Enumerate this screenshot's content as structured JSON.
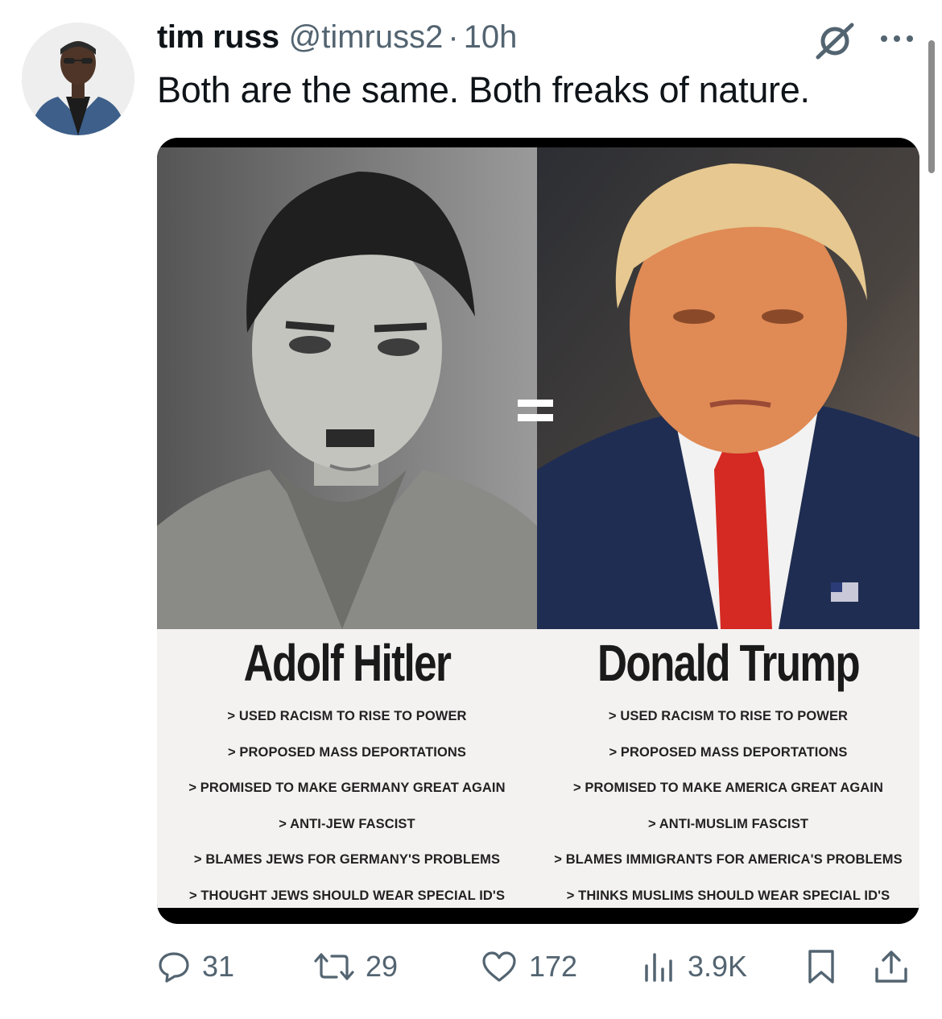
{
  "author": {
    "display_name": "tim russ",
    "handle": "@timruss2",
    "separator": "·",
    "time": "10h"
  },
  "tweet": {
    "text": "Both are the same.  Both freaks of nature."
  },
  "media": {
    "left_column": {
      "name": "Adolf Hitler",
      "points": [
        "> USED RACISM TO RISE TO POWER",
        "> PROPOSED MASS DEPORTATIONS",
        "> PROMISED TO MAKE GERMANY GREAT AGAIN",
        "> ANTI-JEW FASCIST",
        "> BLAMES JEWS FOR GERMANY'S PROBLEMS",
        "> THOUGHT JEWS SHOULD WEAR SPECIAL ID'S"
      ]
    },
    "right_column": {
      "name": "Donald Trump",
      "points": [
        "> USED RACISM TO RISE TO POWER",
        "> PROPOSED MASS DEPORTATIONS",
        "> PROMISED TO MAKE AMERICA GREAT AGAIN",
        "> ANTI-MUSLIM FASCIST",
        "> BLAMES IMMIGRANTS FOR AMERICA'S PROBLEMS",
        "> THINKS MUSLIMS SHOULD WEAR SPECIAL ID'S"
      ]
    }
  },
  "actions": {
    "replies": "31",
    "reposts": "29",
    "likes": "172",
    "views": "3.9K"
  },
  "icons": {
    "reply": "speech-bubble-icon",
    "repost": "repost-arrows-icon",
    "like": "heart-icon",
    "views": "bar-chart-icon",
    "bookmark": "bookmark-icon",
    "share": "share-upload-icon",
    "grok": "grok-slash-circle-icon",
    "more": "more-dots-icon"
  },
  "colors": {
    "text_primary": "#0f1419",
    "text_secondary": "#536471",
    "media_caption_bg": "#f4f1f1"
  }
}
